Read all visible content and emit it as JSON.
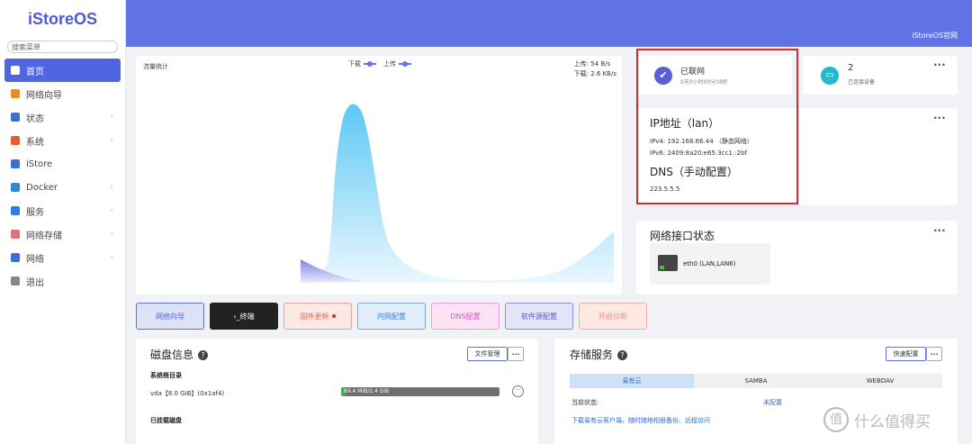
{
  "app": {
    "logo": "iStoreOS",
    "search_placeholder": "搜索菜单"
  },
  "header": {
    "official_link": "iStoreOS官网"
  },
  "sidebar": {
    "items": [
      {
        "label": "首页",
        "icon": "home-icon",
        "active": true,
        "has_chevron": false
      },
      {
        "label": "网络向导",
        "icon": "wizard-icon",
        "active": false,
        "has_chevron": false
      },
      {
        "label": "状态",
        "icon": "status-icon",
        "active": false,
        "has_chevron": true
      },
      {
        "label": "系统",
        "icon": "system-icon",
        "active": false,
        "has_chevron": true
      },
      {
        "label": "iStore",
        "icon": "store-icon",
        "active": false,
        "has_chevron": false
      },
      {
        "label": "Docker",
        "icon": "docker-icon",
        "active": false,
        "has_chevron": true
      },
      {
        "label": "服务",
        "icon": "service-icon",
        "active": false,
        "has_chevron": true
      },
      {
        "label": "网络存储",
        "icon": "nas-icon",
        "active": false,
        "has_chevron": true
      },
      {
        "label": "网络",
        "icon": "network-icon",
        "active": false,
        "has_chevron": true
      },
      {
        "label": "退出",
        "icon": "logout-icon",
        "active": false,
        "has_chevron": false
      }
    ]
  },
  "traffic": {
    "title": "流量统计",
    "legend_download": "下载",
    "legend_upload": "上传",
    "upload_rate": "上传: 54 B/s",
    "download_rate": "下载: 2.6 KB/s"
  },
  "connection": {
    "status": "已联网",
    "uptime": "0天0小时00分08秒"
  },
  "devices": {
    "count": "2",
    "label": "已连接设备"
  },
  "ip_info": {
    "title": "IP地址（lan）",
    "ipv4": "IPv4:  192.168.66.44  （静态网络）",
    "ipv6": "IPv6:  2409:8a20:e65:3cc1::2bf",
    "dns_title": "DNS（手动配置）",
    "dns": "223.5.5.5"
  },
  "interfaces": {
    "title": "网络接口状态",
    "name": "eth0 (LAN,LAN6)"
  },
  "quick_buttons": [
    {
      "label": "网络向导",
      "bg": "#dde2f7",
      "border": "#5f73e6",
      "color": "#4f66e0"
    },
    {
      "label": "›_终端",
      "bg": "#222222",
      "border": "#222222",
      "color": "#ffffff"
    },
    {
      "label": "固件更新",
      "bg": "#fce8e4",
      "border": "#f0a090",
      "color": "#e86a4a"
    },
    {
      "label": "内网配置",
      "bg": "#e1edfb",
      "border": "#7aa7e6",
      "color": "#3f7fd6"
    },
    {
      "label": "DNS配置",
      "bg": "#fbe2f4",
      "border": "#ec9fd8",
      "color": "#e057b9"
    },
    {
      "label": "软件源配置",
      "bg": "#e4e4f7",
      "border": "#8c8ce0",
      "color": "#5a5ac8"
    },
    {
      "label": "开启诊断",
      "bg": "#fde8e4",
      "border": "#f4b0a2",
      "color": "#f08f7d"
    }
  ],
  "disk": {
    "title": "磁盘信息",
    "file_manage": "文件管理",
    "root_label": "系统根目录",
    "vda": "vda【8.0 GiB】(0x1af4)",
    "usage_text": "69.4 MiB/2.4 GiB",
    "usage_fraction": 0.028,
    "mounted_label": "已挂载磁盘"
  },
  "storage": {
    "title": "存储服务",
    "quick_config": "快速配置",
    "tabs": [
      "易有云",
      "SAMBA",
      "WEBDAV"
    ],
    "current_state_label": "当前状态:",
    "current_state_value": "未配置",
    "promo": "下载易有云客户端，随时随地相册备份、远程访问"
  },
  "watermark": {
    "text": "什么值得买",
    "badge": "值"
  }
}
